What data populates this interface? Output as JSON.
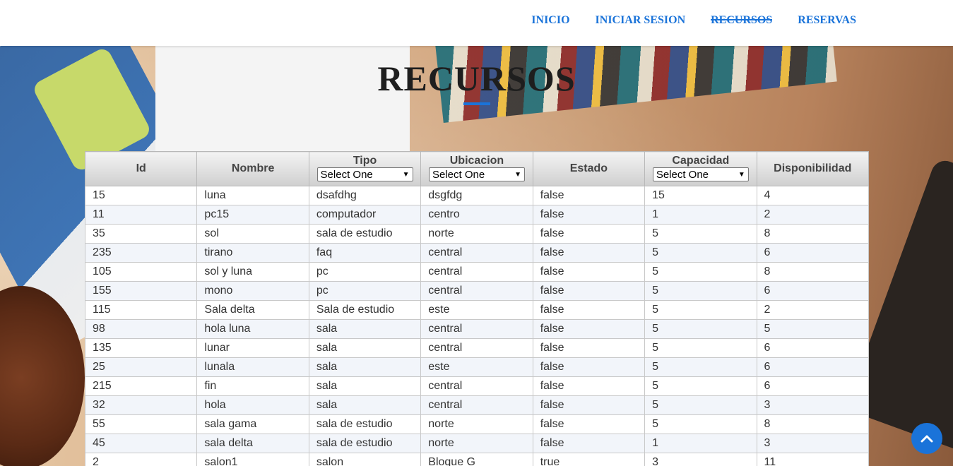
{
  "nav": {
    "items": [
      {
        "label": "INICIO"
      },
      {
        "label": "INICIAR SESION"
      },
      {
        "label": "RECURSOS"
      },
      {
        "label": "RESERVAS"
      }
    ],
    "active": "RECURSOS",
    "accent_color": "#1a73d9"
  },
  "page": {
    "title": "RECURSOS"
  },
  "table": {
    "headers": {
      "id": "Id",
      "nombre": "Nombre",
      "tipo": "Tipo",
      "ubicacion": "Ubicacion",
      "estado": "Estado",
      "capacidad": "Capacidad",
      "disponibilidad": "Disponibilidad"
    },
    "filters": {
      "tipo": "Select One",
      "ubicacion": "Select One",
      "capacidad": "Select One"
    },
    "rows": [
      [
        "15",
        "luna",
        "dsafdhg",
        "dsgfdg",
        "false",
        "15",
        "4"
      ],
      [
        "11",
        "pc15",
        "computador",
        "centro",
        "false",
        "1",
        "2"
      ],
      [
        "35",
        "sol",
        "sala de estudio",
        "norte",
        "false",
        "5",
        "8"
      ],
      [
        "235",
        "tirano",
        "faq",
        "central",
        "false",
        "5",
        "6"
      ],
      [
        "105",
        "sol y luna",
        "pc",
        "central",
        "false",
        "5",
        "8"
      ],
      [
        "155",
        "mono",
        "pc",
        "central",
        "false",
        "5",
        "6"
      ],
      [
        "115",
        "Sala delta",
        "Sala de estudio",
        "este",
        "false",
        "5",
        "2"
      ],
      [
        "98",
        "hola luna",
        "sala",
        "central",
        "false",
        "5",
        "5"
      ],
      [
        "135",
        "lunar",
        "sala",
        "central",
        "false",
        "5",
        "6"
      ],
      [
        "25",
        "lunala",
        "sala",
        "este",
        "false",
        "5",
        "6"
      ],
      [
        "215",
        "fin",
        "sala",
        "central",
        "false",
        "5",
        "6"
      ],
      [
        "32",
        "hola",
        "sala",
        "central",
        "false",
        "5",
        "3"
      ],
      [
        "55",
        "sala gama",
        "sala de estudio",
        "norte",
        "false",
        "5",
        "8"
      ],
      [
        "45",
        "sala delta",
        "sala de estudio",
        "norte",
        "false",
        "1",
        "3"
      ],
      [
        "2",
        "salon1",
        "salon",
        "Bloque G",
        "true",
        "3",
        "11"
      ]
    ]
  },
  "scroll_top": {
    "icon": "chevron-up-icon"
  }
}
